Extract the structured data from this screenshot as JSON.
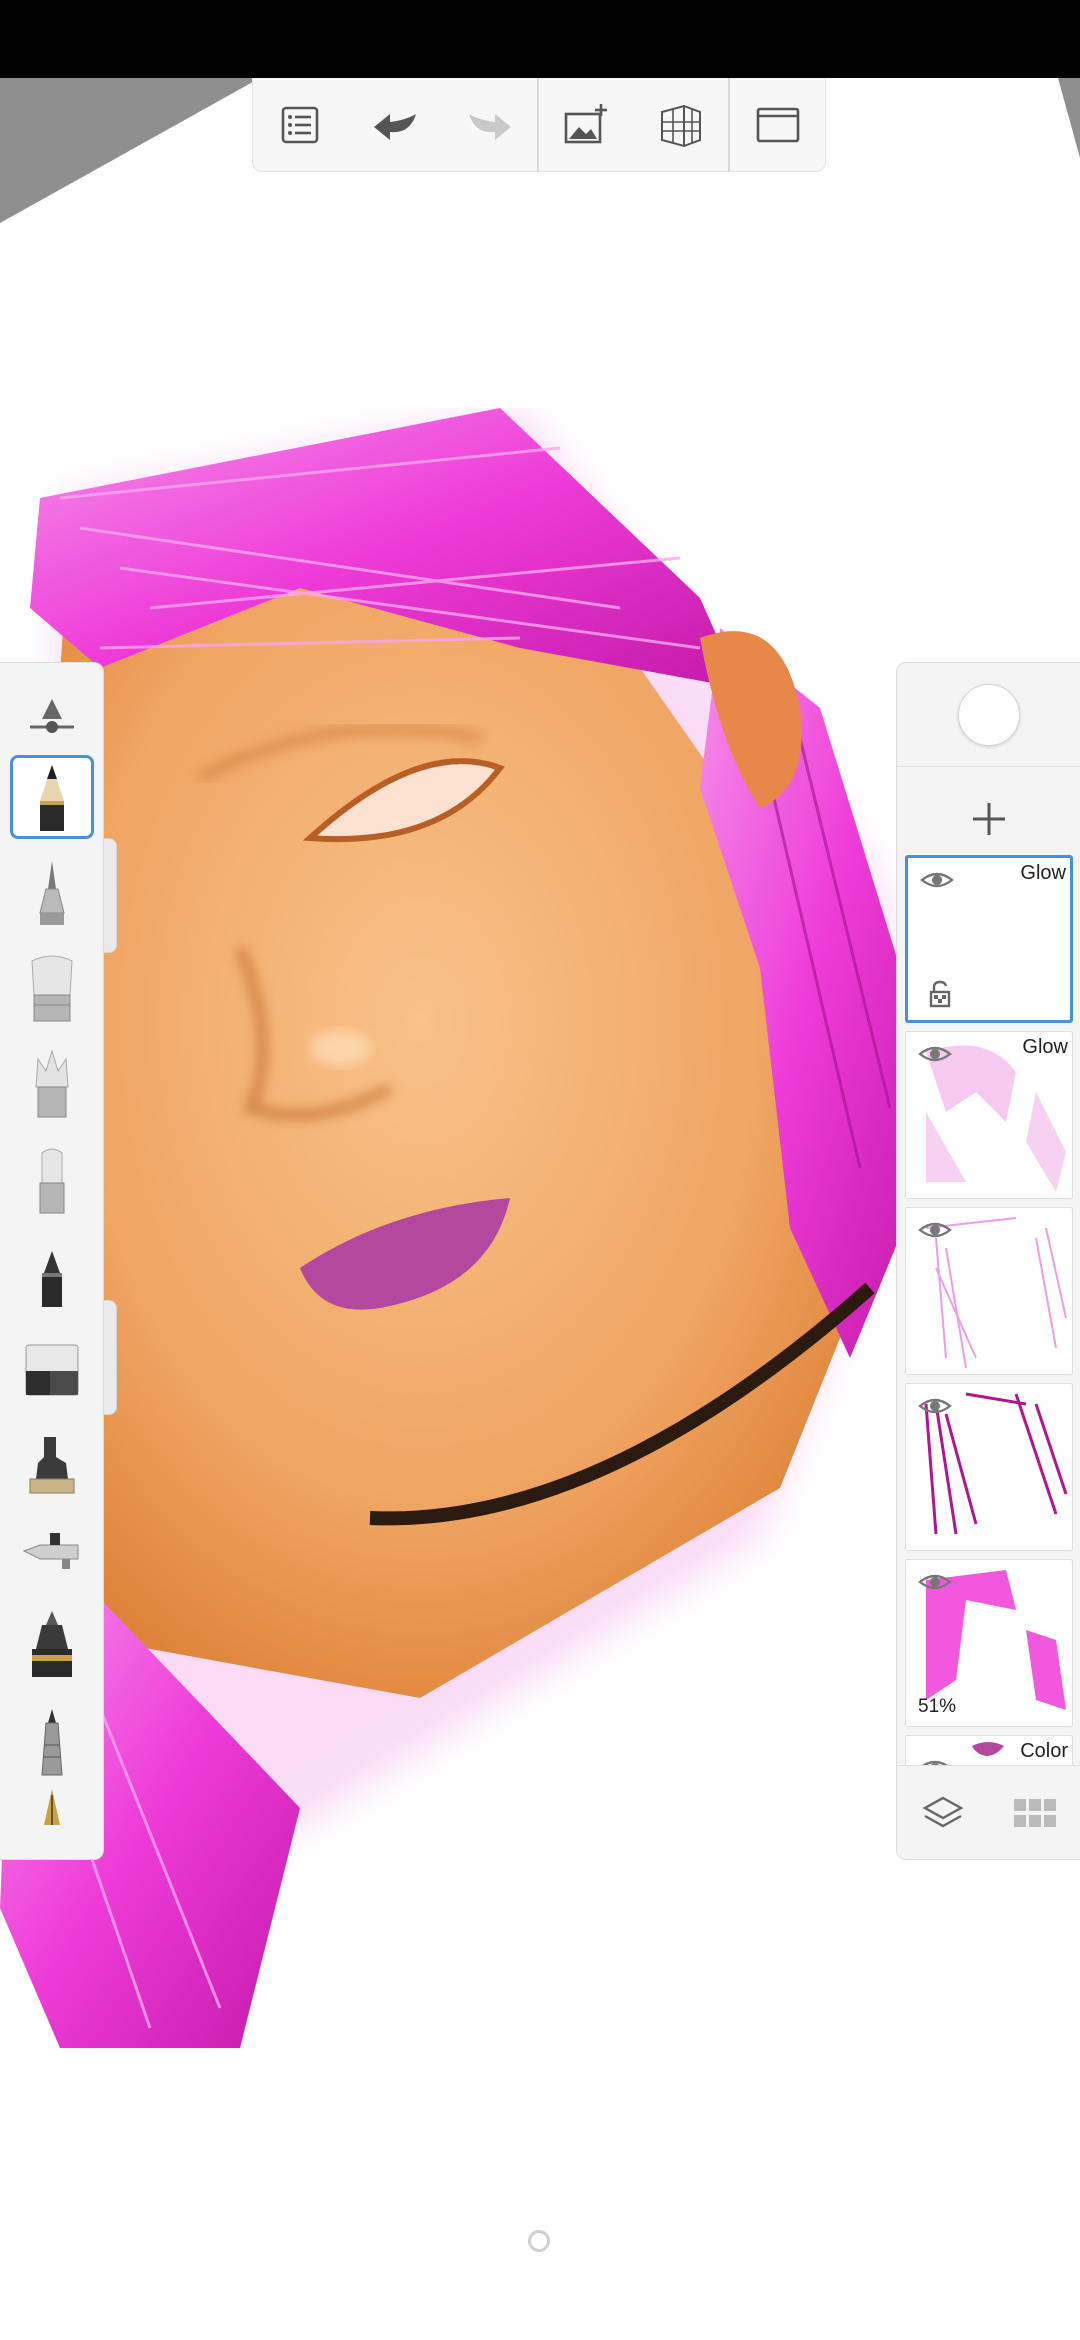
{
  "app": {
    "accent_color": "#4a90d9"
  },
  "toolbar": {
    "buttons": [
      {
        "name": "list-menu",
        "icon": "list-icon"
      },
      {
        "name": "undo",
        "icon": "undo-arrow-icon"
      },
      {
        "name": "redo",
        "icon": "redo-arrow-icon",
        "enabled": false
      },
      {
        "name": "add-image",
        "icon": "add-image-icon"
      },
      {
        "name": "perspective-guide",
        "icon": "perspective-grid-icon"
      },
      {
        "name": "fullscreen",
        "icon": "fullscreen-frame-icon"
      }
    ]
  },
  "brushes": {
    "selected": "pencil",
    "items": [
      "brush-size-opacity",
      "pencil",
      "ballpoint",
      "soft-brush",
      "paint-brush",
      "flat-brush",
      "marker",
      "eraser",
      "smudge",
      "airbrush",
      "fill-pen",
      "fine-pen",
      "quill"
    ]
  },
  "layers": {
    "items": [
      {
        "blend": "Glow",
        "visible": true,
        "active": true,
        "locked_transparency": true
      },
      {
        "blend": "Glow",
        "visible": true
      },
      {
        "blend": "",
        "visible": true
      },
      {
        "blend": "",
        "visible": true
      },
      {
        "blend": "",
        "visible": true,
        "opacity": "51%"
      },
      {
        "blend": "Color",
        "visible": true
      }
    ]
  },
  "colors": {
    "hair": "#ee3bd8",
    "skin": "#f0a563",
    "lips": "#b3489e",
    "canvas_corner": "#8f8f8f"
  }
}
